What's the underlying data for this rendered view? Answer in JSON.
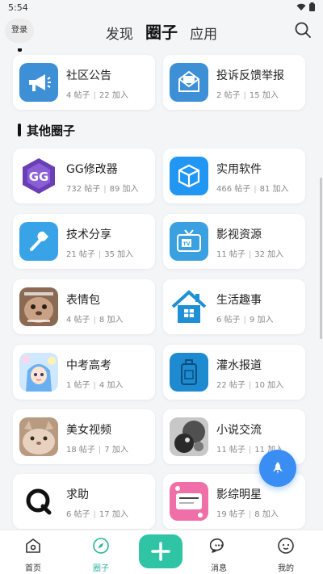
{
  "status_bar": {
    "time": "5:54"
  },
  "header": {
    "login_label": "登录",
    "tabs": [
      {
        "label": "发现"
      },
      {
        "label": "圈子"
      },
      {
        "label": "应用"
      }
    ]
  },
  "top_circles": [
    {
      "name": "社区公告",
      "posts": "4 帖子",
      "joined": "22 加入",
      "icon": "megaphone-icon",
      "color": "#3d8fd6"
    },
    {
      "name": "投诉反馈举报",
      "posts": "2 帖子",
      "joined": "15 加入",
      "icon": "mail-icon",
      "color": "#3d8fd6"
    }
  ],
  "section": {
    "title": "其他圈子"
  },
  "circles": [
    {
      "name": "GG修改器",
      "posts": "732 帖子",
      "joined": "89 加入",
      "icon": "gg-logo-icon"
    },
    {
      "name": "实用软件",
      "posts": "466 帖子",
      "joined": "81 加入",
      "icon": "box-icon"
    },
    {
      "name": "技术分享",
      "posts": "21 帖子",
      "joined": "35 加入",
      "icon": "wrench-icon"
    },
    {
      "name": "影视资源",
      "posts": "11 帖子",
      "joined": "32 加入",
      "icon": "tv-icon"
    },
    {
      "name": "表情包",
      "posts": "4 帖子",
      "joined": "8 加入",
      "icon": "cat-meme-image"
    },
    {
      "name": "生活趣事",
      "posts": "6 帖子",
      "joined": "9 加入",
      "icon": "house-icon"
    },
    {
      "name": "中考高考",
      "posts": "1 帖子",
      "joined": "4 加入",
      "icon": "anime-girl-image"
    },
    {
      "name": "灌水报道",
      "posts": "22 帖子",
      "joined": "10 加入",
      "icon": "bottle-icon"
    },
    {
      "name": "美女视频",
      "posts": "18 帖子",
      "joined": "7 加入",
      "icon": "cat-photo-image"
    },
    {
      "name": "小说交流",
      "posts": "11 帖子",
      "joined": "11 加入",
      "icon": "dark-photo-image"
    },
    {
      "name": "求助",
      "posts": "6 帖子",
      "joined": "17 加入",
      "icon": "q-logo-icon"
    },
    {
      "name": "影综明星",
      "posts": "19 帖子",
      "joined": "8 加入",
      "icon": "pink-frame-image"
    }
  ],
  "bottom_nav": [
    {
      "label": "首页",
      "icon": "home-icon"
    },
    {
      "label": "圈子",
      "icon": "compass-icon"
    },
    {
      "label": "",
      "icon": "plus-icon"
    },
    {
      "label": "消息",
      "icon": "chat-icon"
    },
    {
      "label": "我的",
      "icon": "profile-icon"
    }
  ],
  "colors": {
    "accent": "#2ec4a4",
    "fab": "#3a8df2",
    "card_icon_blue": "#3d8fd6"
  }
}
